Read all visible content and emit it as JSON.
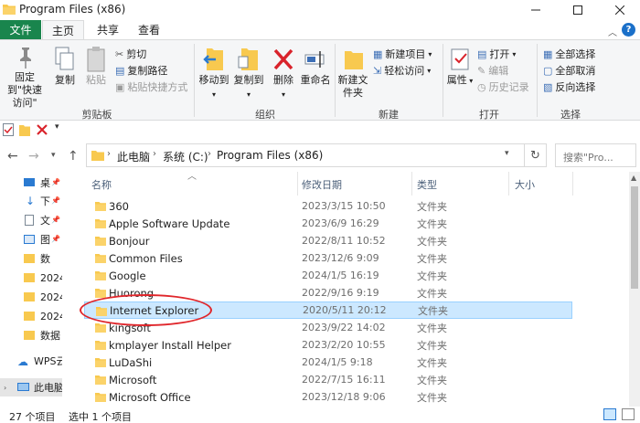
{
  "window": {
    "title": "Program Files (x86)"
  },
  "tabs": {
    "file": "文件",
    "home": "主页",
    "share": "共享",
    "view": "查看"
  },
  "ribbon": {
    "clipboard": {
      "pin_quick_access": "固定到\"快速访问\"",
      "copy": "复制",
      "paste": "粘贴",
      "cut": "剪切",
      "copy_path": "复制路径",
      "paste_shortcut": "粘贴快捷方式",
      "label": "剪贴板"
    },
    "organize": {
      "move_to": "移动到",
      "copy_to": "复制到",
      "delete": "删除",
      "rename": "重命名",
      "label": "组织"
    },
    "new": {
      "new_folder": "新建文件夹",
      "new_item": "新建项目",
      "easy_access": "轻松访问",
      "label": "新建"
    },
    "open": {
      "properties": "属性",
      "open": "打开",
      "edit": "编辑",
      "history": "历史记录",
      "label": "打开"
    },
    "select": {
      "select_all": "全部选择",
      "select_none": "全部取消",
      "invert": "反向选择",
      "label": "选择"
    }
  },
  "address": {
    "crumbs": [
      "此电脑",
      "系统 (C:)",
      "Program Files (x86)"
    ],
    "search_placeholder": "搜索\"Pro..."
  },
  "navpane": {
    "items": [
      {
        "label": "桌"
      },
      {
        "label": "下"
      },
      {
        "label": "文"
      },
      {
        "label": "图"
      },
      {
        "label": "数"
      },
      {
        "label": "2024"
      },
      {
        "label": "2024"
      },
      {
        "label": "2024"
      },
      {
        "label": "数据"
      },
      {
        "label": "WPS云"
      },
      {
        "label": "此电脑"
      }
    ]
  },
  "columns": {
    "name": "名称",
    "date": "修改日期",
    "type": "类型",
    "size": "大小"
  },
  "files": [
    {
      "name": "360",
      "date": "2023/3/15 10:50",
      "type": "文件夹"
    },
    {
      "name": "Apple Software Update",
      "date": "2023/6/9 16:29",
      "type": "文件夹"
    },
    {
      "name": "Bonjour",
      "date": "2022/8/11 10:52",
      "type": "文件夹"
    },
    {
      "name": "Common Files",
      "date": "2023/12/6 9:09",
      "type": "文件夹"
    },
    {
      "name": "Google",
      "date": "2024/1/5 16:19",
      "type": "文件夹"
    },
    {
      "name": "Huorong",
      "date": "2022/9/16 9:19",
      "type": "文件夹"
    },
    {
      "name": "Internet Explorer",
      "date": "2020/5/11 20:12",
      "type": "文件夹"
    },
    {
      "name": "kingsoft",
      "date": "2023/9/22 14:02",
      "type": "文件夹"
    },
    {
      "name": "kmplayer Install Helper",
      "date": "2023/2/20 10:55",
      "type": "文件夹"
    },
    {
      "name": "LuDaShi",
      "date": "2024/1/5 9:18",
      "type": "文件夹"
    },
    {
      "name": "Microsoft",
      "date": "2022/7/15 16:11",
      "type": "文件夹"
    },
    {
      "name": "Microsoft Office",
      "date": "2023/12/18 9:06",
      "type": "文件夹"
    }
  ],
  "status": {
    "item_count": "27 个项目",
    "selected": "选中 1 个项目"
  },
  "colors": {
    "file_tab": "#19854d",
    "selection": "#cce8ff",
    "folder": "#f8c94f",
    "annotation": "#e0262b"
  }
}
